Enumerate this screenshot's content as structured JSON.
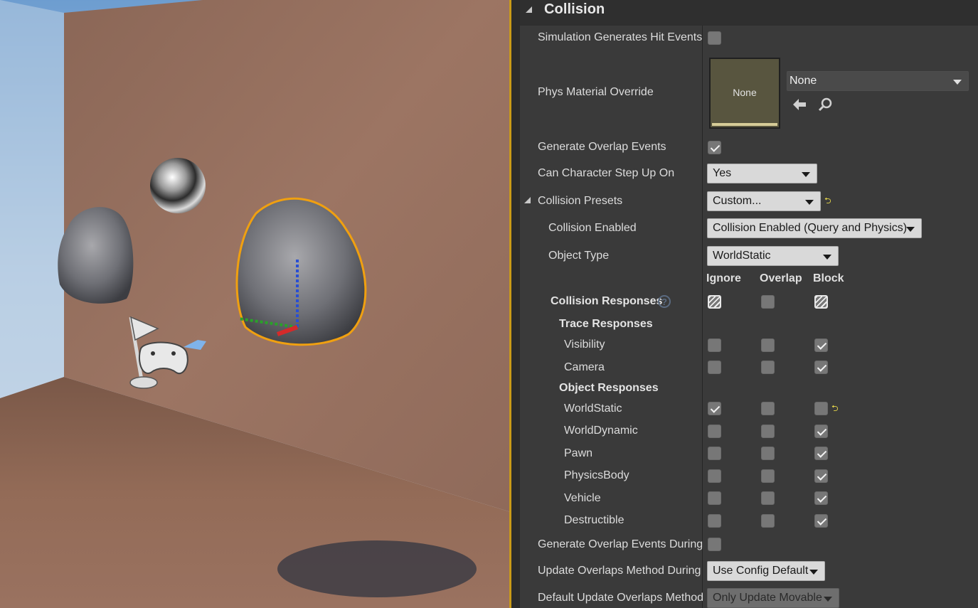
{
  "panel": {
    "section_title": "Collision",
    "rows": {
      "sim_hit": "Simulation Generates Hit Events",
      "phys_override": "Phys Material Override",
      "gen_overlap": "Generate Overlap Events",
      "step_up": "Can Character Step Up On",
      "presets": "Collision Presets",
      "enabled": "Collision Enabled",
      "object_type": "Object Type",
      "collision_responses": "Collision Responses",
      "trace_responses": "Trace Responses",
      "visibility": "Visibility",
      "camera": "Camera",
      "object_responses": "Object Responses",
      "worldstatic": "WorldStatic",
      "worlddynamic": "WorldDynamic",
      "pawn": "Pawn",
      "physicsbody": "PhysicsBody",
      "vehicle": "Vehicle",
      "destructible": "Destructible",
      "gen_overlap_during": "Generate Overlap Events During",
      "update_overlaps": "Update Overlaps Method During",
      "default_update": "Default Update Overlaps Method"
    },
    "columns": {
      "ignore": "Ignore",
      "overlap": "Overlap",
      "block": "Block"
    },
    "values": {
      "phys_thumb": "None",
      "phys_select": "None",
      "step_up": "Yes",
      "presets": "Custom...",
      "enabled": "Collision Enabled (Query and Physics)",
      "object_type": "WorldStatic",
      "update_overlaps": "Use Config Default",
      "default_update": "Only Update Movable"
    },
    "help_glyph": "?",
    "reset_glyph": "⮌",
    "checkbox_states": {
      "sim_hit": false,
      "gen_overlap": true,
      "gen_overlap_during": false,
      "visibility": "block",
      "camera": "block",
      "worldstatic": "ignore",
      "worlddynamic": "block",
      "pawn": "block",
      "physicsbody": "block",
      "vehicle": "block",
      "destructible": "block"
    },
    "icons": [
      "back-arrow-icon",
      "magnifier-icon",
      "reset-to-default-icon",
      "help-icon",
      "expand-triangle-icon",
      "dropdown-arrow-icon"
    ]
  },
  "viewport": {
    "objects": [
      "wall",
      "floor",
      "sky",
      "reflection-sphere",
      "rock-left",
      "rock-selected",
      "player-start-icon",
      "transform-gizmo",
      "shadow"
    ]
  }
}
